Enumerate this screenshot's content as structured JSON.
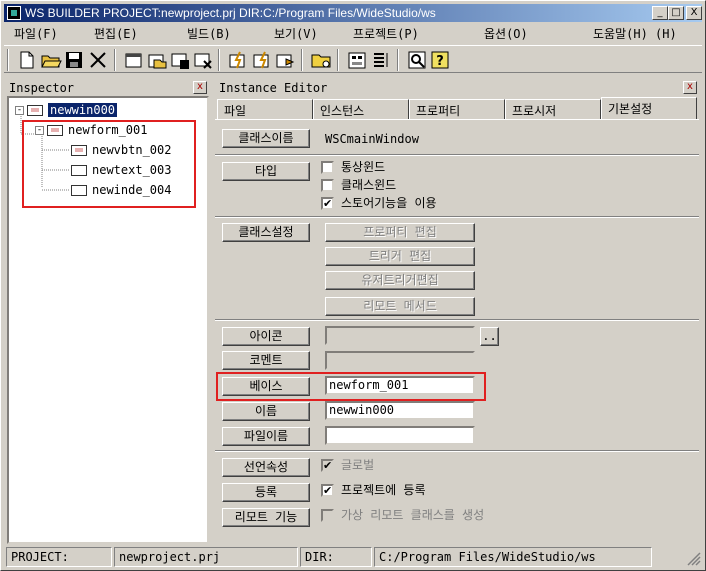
{
  "window": {
    "title": "WS BUILDER PROJECT:newproject.prj DIR:C:/Program Files/WideStudio/ws",
    "minimize": "_",
    "maximize": "□",
    "close": "X"
  },
  "menu": [
    "파일(F)",
    "편집(E)",
    "빌드(B)",
    "보기(V)",
    "프로젝트(P)",
    "옵션(O)",
    "도움말(H) (H)"
  ],
  "toolbar_icons": [
    "new-file-icon",
    "open-folder-icon",
    "save-icon",
    "cut-icon",
    "new-window-icon",
    "open-window-icon",
    "save-window-icon",
    "close-window-icon",
    "build-icon",
    "make-icon",
    "run-icon",
    "folder-icon",
    "editor-icon",
    "list-icon",
    "find-icon",
    "help-icon"
  ],
  "inspector": {
    "title": "Inspector",
    "close": "x",
    "tree": [
      {
        "label": "newwin000",
        "expander": "-",
        "selected": true
      },
      {
        "label": "newform_001",
        "expander": "-"
      },
      {
        "label": "newvbtn_002"
      },
      {
        "label": "newtext_003"
      },
      {
        "label": "newinde_004"
      }
    ]
  },
  "editor": {
    "title": "Instance Editor",
    "close": "x",
    "tabs": [
      "파일",
      "인스턴스",
      "프로퍼티",
      "프로시저",
      "기본설정"
    ],
    "class_name_button": "클래스이름",
    "class_name_value": "WSCmainWindow",
    "type_button": "타입",
    "type_options": [
      {
        "label": "통상윈드",
        "checked": false
      },
      {
        "label": "클래스윈드",
        "checked": false
      },
      {
        "label": "스토어기능을 이용",
        "checked": true
      }
    ],
    "class_settings_button": "클래스설정",
    "class_settings_actions": [
      "프로퍼티 편집",
      "트리거 편집",
      "유저트리거편집",
      "리모트 메서드"
    ],
    "icon_button": "아이콘",
    "icon_value": "",
    "icon_browse": "..",
    "comment_button": "코멘트",
    "comment_value": "",
    "base_button": "베이스",
    "base_value": "newform_001",
    "name_button": "이름",
    "name_value": "newwin000",
    "filename_button": "파일이름",
    "filename_value": "",
    "declaration_button": "선언속성",
    "global_label": "글로벌",
    "global_checked": true,
    "register_button": "등록",
    "register_label": "프로젝트에 등록",
    "register_checked": true,
    "remote_button": "리모트 기능",
    "remote_label": "가상 리모트 클래스를 생성",
    "remote_checked": false
  },
  "status": {
    "project_label": "PROJECT:",
    "project_value": "newproject.prj",
    "dir_label": "DIR:",
    "dir_value": "C:/Program Files/WideStudio/ws"
  },
  "colors": {
    "titlebar": "#0a246a",
    "highlight": "#e02020",
    "selection": "#0a246a"
  }
}
